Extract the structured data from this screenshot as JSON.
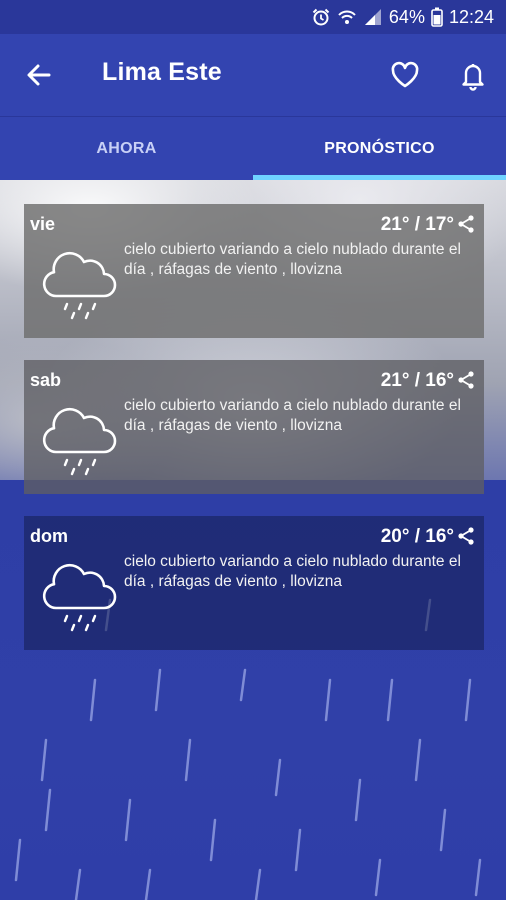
{
  "status_bar": {
    "alarm_icon": "alarm-clock-icon",
    "wifi_icon": "wifi-icon",
    "signal_icon": "signal-icon",
    "battery_percent": "64%",
    "battery_icon": "battery-icon",
    "time": "12:24"
  },
  "app_bar": {
    "title": "Lima Este",
    "back_icon": "arrow-left-icon",
    "favorite_icon": "heart-outline-icon",
    "notification_icon": "bell-icon"
  },
  "tabs": [
    {
      "label": "AHORA",
      "active": false
    },
    {
      "label": "PRONÓSTICO",
      "active": true
    }
  ],
  "forecast": [
    {
      "day": "vie",
      "temps": "21° / 17°",
      "description": "cielo cubierto variando a cielo nublado durante el día , ráfagas de viento , llovizna",
      "icon": "cloud-drizzle-icon"
    },
    {
      "day": "sab",
      "temps": "21° / 16°",
      "description": "cielo cubierto variando a cielo nublado durante el día , ráfagas de viento , llovizna",
      "icon": "cloud-drizzle-icon"
    },
    {
      "day": "dom",
      "temps": "20° / 16°",
      "description": "cielo cubierto variando a cielo nublado durante el día , ráfagas de viento , llovizna",
      "icon": "cloud-drizzle-icon"
    }
  ],
  "colors": {
    "app_bar": "#3344b0",
    "status_bar": "#2a379a",
    "tab_indicator": "#6fd3ff",
    "background_rain": "#2e3ea6"
  }
}
